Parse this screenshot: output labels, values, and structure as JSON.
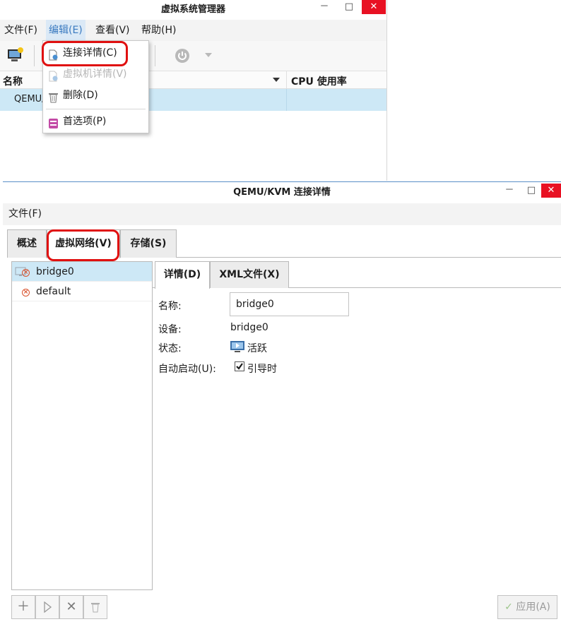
{
  "main_window": {
    "title": "虚拟系统管理器",
    "controls": {
      "minimize": "－",
      "maximize": "□",
      "close": "✕"
    },
    "menu": [
      "文件(F)",
      "编辑(E)",
      "查看(V)",
      "帮助(H)"
    ],
    "columns": {
      "name": "名称",
      "cpu": "CPU 使用率"
    },
    "connection_row": "QEMU/"
  },
  "edit_menu": {
    "items": [
      {
        "label": "连接详情(C)",
        "enabled": true,
        "icon": "document-info-icon"
      },
      {
        "label": "虚拟机详情(V)",
        "enabled": false,
        "icon": "document-info-icon"
      },
      {
        "label": "删除(D)",
        "enabled": true,
        "icon": "trash-icon"
      },
      {
        "label": "首选项(P)",
        "enabled": true,
        "icon": "preferences-icon"
      }
    ]
  },
  "details_window": {
    "title": "QEMU/KVM 连接详情",
    "controls": {
      "minimize": "－",
      "maximize": "□",
      "close": "✕"
    },
    "menu": [
      "文件(F)"
    ],
    "tabs": [
      "概述",
      "虚拟网络(V)",
      "存储(S)"
    ],
    "networks": [
      {
        "name": "bridge0",
        "selected": true,
        "status_icon": "error-circle-icon"
      },
      {
        "name": "default",
        "selected": false,
        "status_icon": "error-circle-icon"
      }
    ],
    "subtabs": [
      "详情(D)",
      "XML文件(X)"
    ],
    "fields": {
      "name_label": "名称:",
      "name_value": "bridge0",
      "device_label": "设备:",
      "device_value": "bridge0",
      "state_label": "状态:",
      "state_value": "活跃",
      "autostart_label": "自动启动(U):",
      "autostart_value": "引导时",
      "autostart_checked": true
    },
    "bottom_buttons": [
      "add-icon",
      "start-icon",
      "stop-icon",
      "delete-icon"
    ],
    "apply_label": "应用(A)"
  },
  "colors": {
    "selection": "#cde8f6",
    "highlight_ring": "#e01010",
    "close_button": "#e81123",
    "menu_active_text": "#3a7ac0"
  }
}
